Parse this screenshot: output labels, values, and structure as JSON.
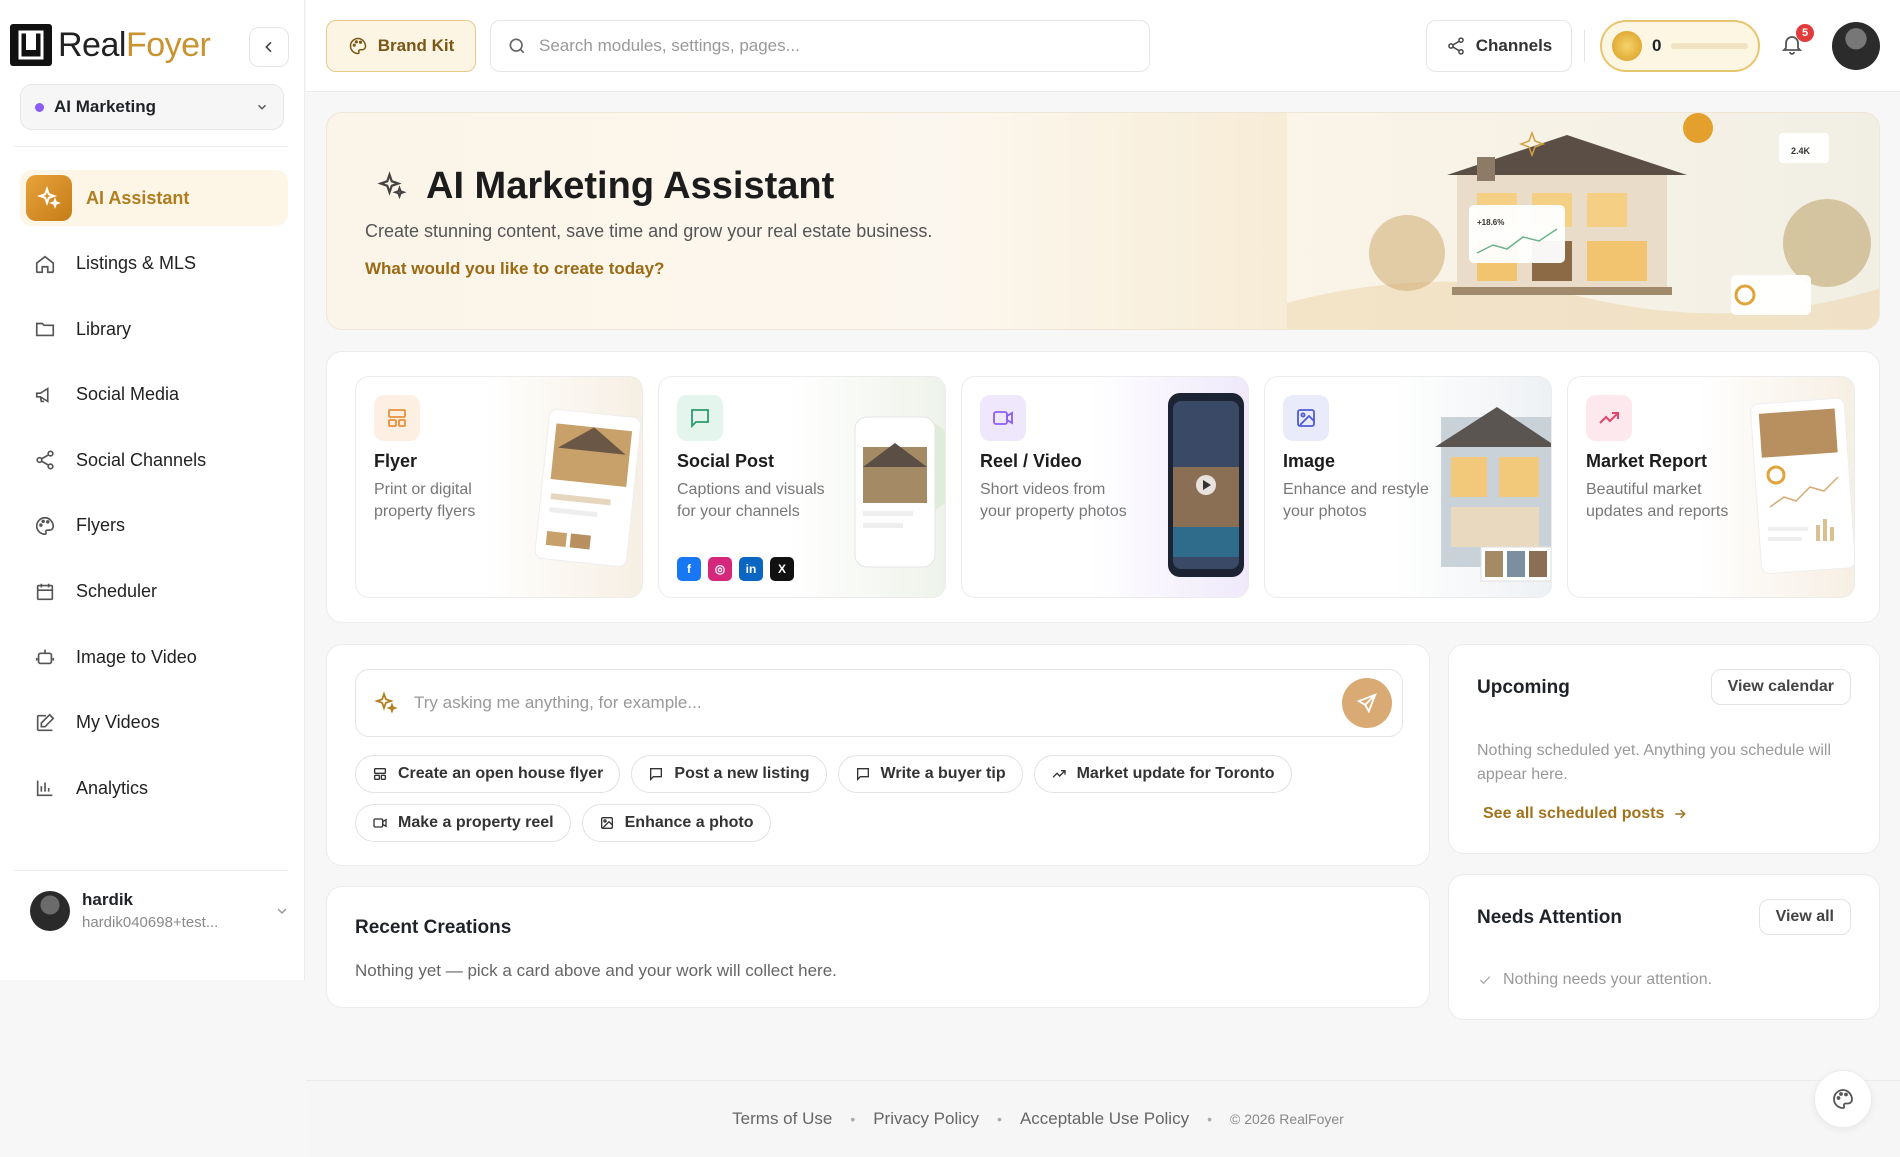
{
  "brand": {
    "name_a": "Real",
    "name_b": "Foyer"
  },
  "workspace": {
    "label": "AI Marketing",
    "dot_color": "#8b5cf6"
  },
  "sidebar": {
    "items": [
      {
        "label": "AI Assistant",
        "icon": "sparkles-icon",
        "active": true
      },
      {
        "label": "Listings & MLS",
        "icon": "home-icon"
      },
      {
        "label": "Library",
        "icon": "folder-icon"
      },
      {
        "label": "Social Media",
        "icon": "megaphone-icon"
      },
      {
        "label": "Social Channels",
        "icon": "share-icon"
      },
      {
        "label": "Flyers",
        "icon": "palette-icon"
      },
      {
        "label": "Scheduler",
        "icon": "calendar-icon"
      },
      {
        "label": "Image to Video",
        "icon": "robot-icon"
      },
      {
        "label": "My Videos",
        "icon": "edit-icon"
      },
      {
        "label": "Analytics",
        "icon": "bar-chart-icon"
      }
    ]
  },
  "user": {
    "name": "hardik",
    "email": "hardik040698+test..."
  },
  "topbar": {
    "brand_kit": "Brand Kit",
    "search_placeholder": "Search modules, settings, pages...",
    "channels": "Channels",
    "credits": "0",
    "notifications": "5"
  },
  "hero": {
    "title": "AI Marketing Assistant",
    "subtitle": "Create stunning content, save time and grow your real estate business.",
    "question": "What would you like to create today?",
    "art_stat_1": "+18.6%",
    "art_stat_2": "2.4K"
  },
  "cards": [
    {
      "title": "Flyer",
      "desc": "Print or digital property flyers",
      "icon": "layout-icon",
      "color": "#e8903a",
      "bg": "#fdf0e3"
    },
    {
      "title": "Social Post",
      "desc": "Captions and visuals for your channels",
      "icon": "message-square-icon",
      "color": "#2e9b6b",
      "bg": "#e3f5ec"
    },
    {
      "title": "Reel / Video",
      "desc": "Short videos from your property photos",
      "icon": "video-icon",
      "color": "#8b5cf6",
      "bg": "#efe8fd"
    },
    {
      "title": "Image",
      "desc": "Enhance and restyle your photos",
      "icon": "image-icon",
      "color": "#4f5bd5",
      "bg": "#e9ebfb"
    },
    {
      "title": "Market Report",
      "desc": "Beautiful market updates and reports",
      "icon": "trending-up-icon",
      "color": "#e0456b",
      "bg": "#fde8ee"
    }
  ],
  "social_icons": [
    {
      "label": "f",
      "color": "#1877f2",
      "name": "facebook-icon"
    },
    {
      "label": "◎",
      "color": "#d6287a",
      "name": "instagram-icon"
    },
    {
      "label": "in",
      "color": "#0a66c2",
      "name": "linkedin-icon"
    },
    {
      "label": "X",
      "color": "#111111",
      "name": "x-icon"
    }
  ],
  "chat": {
    "placeholder": "Try asking me anything, for example...",
    "chips": [
      {
        "label": "Create an open house flyer",
        "icon": "layout-icon"
      },
      {
        "label": "Post a new listing",
        "icon": "message-square-icon"
      },
      {
        "label": "Write a buyer tip",
        "icon": "message-square-icon"
      },
      {
        "label": "Market update for Toronto",
        "icon": "trending-up-icon"
      },
      {
        "label": "Make a property reel",
        "icon": "video-icon"
      },
      {
        "label": "Enhance a photo",
        "icon": "image-icon"
      }
    ]
  },
  "recent": {
    "title": "Recent Creations",
    "text": "Nothing yet — pick a card above and your work will collect here."
  },
  "upcoming": {
    "title": "Upcoming",
    "button": "View calendar",
    "text": "Nothing scheduled yet. Anything you schedule will appear here.",
    "link": "See all scheduled posts"
  },
  "attention": {
    "title": "Needs Attention",
    "button": "View all",
    "text": "Nothing needs your attention."
  },
  "footer": {
    "links": [
      "Terms of Use",
      "Privacy Policy",
      "Acceptable Use Policy"
    ],
    "copyright": "© 2026 RealFoyer"
  }
}
